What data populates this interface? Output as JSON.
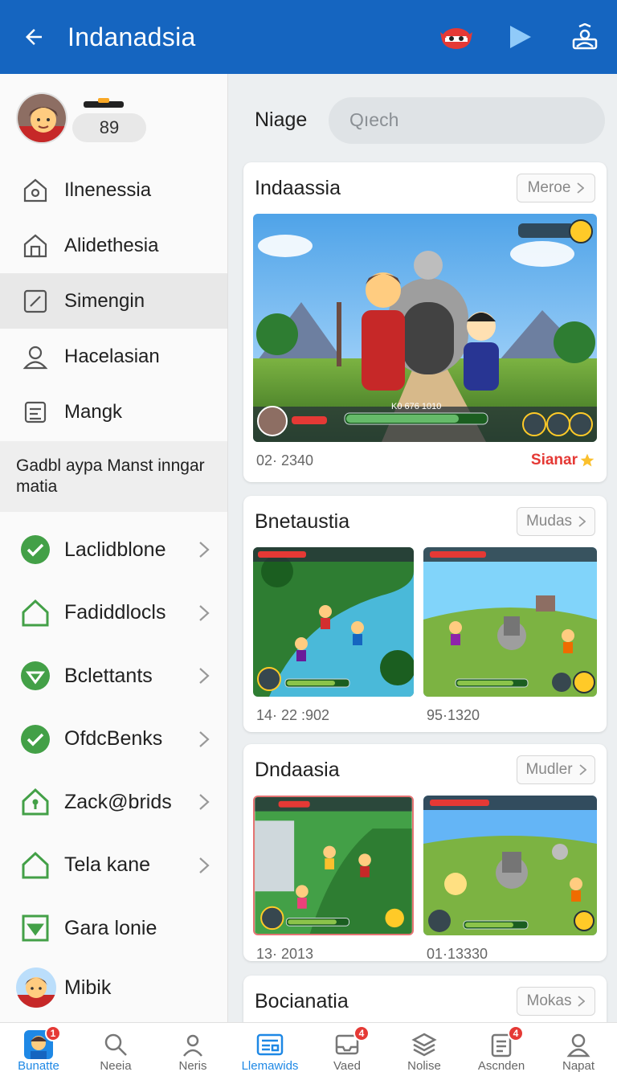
{
  "appbar": {
    "title": "Indanadsia"
  },
  "profile": {
    "coins": "89"
  },
  "menu": [
    {
      "label": "Ilnenessia",
      "icon": "home-settings-icon"
    },
    {
      "label": "Alidethesia",
      "icon": "home-icon"
    },
    {
      "label": "Simengin",
      "icon": "edit-icon",
      "active": true
    },
    {
      "label": "Hacelasian",
      "icon": "person-icon"
    },
    {
      "label": "Mangk",
      "icon": "document-icon"
    }
  ],
  "promo": {
    "text": "Gadbl aypa Manst inngar matia"
  },
  "categories": [
    {
      "label": "Laclidblone",
      "icon": "check-circle-icon"
    },
    {
      "label": "Fadiddlocls",
      "icon": "house-outline-icon"
    },
    {
      "label": "Bclettants",
      "icon": "shield-down-icon"
    },
    {
      "label": "OfdcBenks",
      "icon": "check-circle-icon"
    },
    {
      "label": "Zack@brids",
      "icon": "home-lock-icon"
    },
    {
      "label": "Tela kane",
      "icon": "house-outline-icon"
    },
    {
      "label": "Gara lonie",
      "icon": "down-box-icon"
    }
  ],
  "sidebar_user": {
    "name": "Mibik"
  },
  "search": {
    "label": "Niage",
    "placeholder": "Qıech"
  },
  "cards": [
    {
      "title": "Indaassia",
      "more": "Meroe",
      "date": "02· 2340",
      "rating": "Sianar",
      "hud": "K0 676 1010"
    },
    {
      "title": "Bnetaustia",
      "more": "Mudas",
      "dates": [
        "14· 22 :902",
        "95·1320"
      ]
    },
    {
      "title": "Dndaasia",
      "more": "Mudler",
      "dates": [
        "13· 2013",
        "01·13330"
      ]
    },
    {
      "title": "Bocianatia",
      "more": "Mokas"
    }
  ],
  "bottom_nav": [
    {
      "label": "Bunatte",
      "icon": "avatar-icon",
      "badge": "1"
    },
    {
      "label": "Neeia",
      "icon": "search-icon"
    },
    {
      "label": "Neris",
      "icon": "person-icon"
    },
    {
      "label": "Llemawids",
      "icon": "newspaper-icon",
      "active": true
    },
    {
      "label": "Vaed",
      "icon": "inbox-icon",
      "badge": "4"
    },
    {
      "label": "Nolise",
      "icon": "layers-icon"
    },
    {
      "label": "Ascnden",
      "icon": "clipboard-icon",
      "badge": "4"
    },
    {
      "label": "Napat",
      "icon": "account-icon"
    }
  ],
  "colors": {
    "primary": "#1565c0",
    "accent_active": "#1e88e5",
    "green_icon": "#43a047",
    "badge_red": "#e53935"
  }
}
